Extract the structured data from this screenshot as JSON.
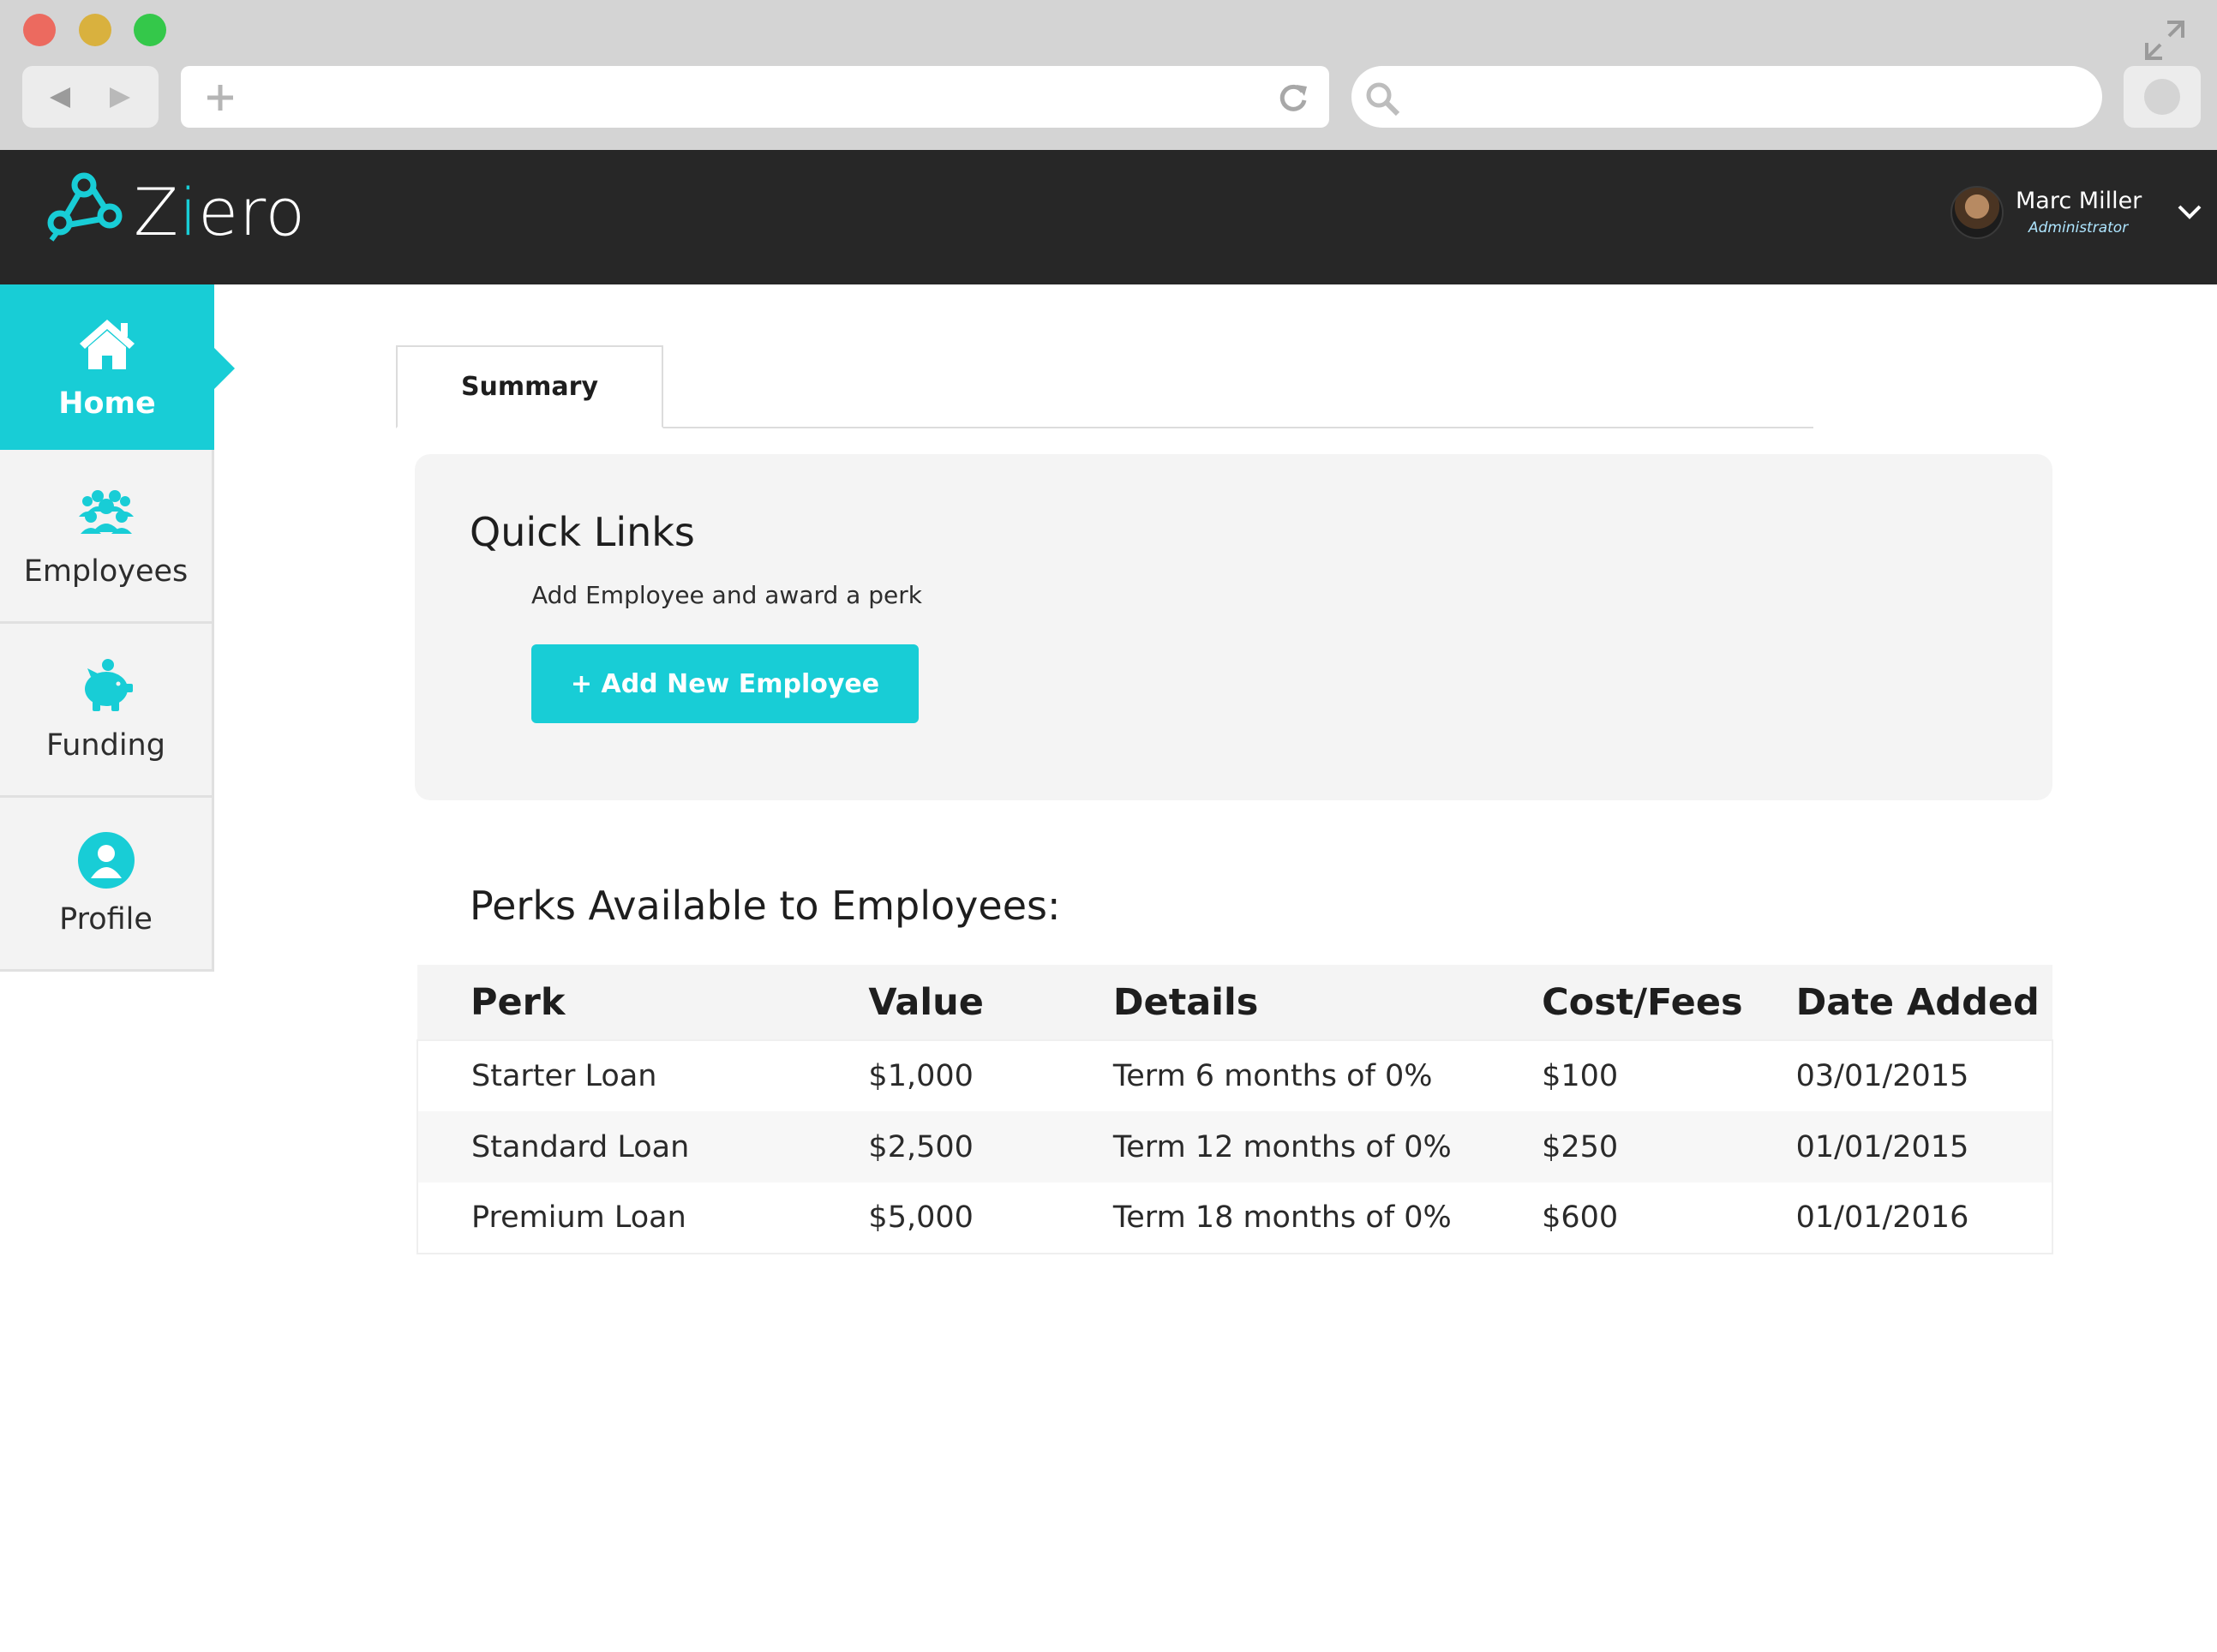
{
  "header": {
    "logo_prefix": "Z",
    "logo_i": "i",
    "logo_suffix": "ero",
    "user_name": "Marc Miller",
    "user_role": "Administrator"
  },
  "sidebar": {
    "items": [
      {
        "label": "Home",
        "icon": "home-icon"
      },
      {
        "label": "Employees",
        "icon": "employees-icon"
      },
      {
        "label": "Funding",
        "icon": "piggy-bank-icon"
      },
      {
        "label": "Profile",
        "icon": "profile-icon"
      }
    ]
  },
  "tabs": {
    "summary_label": "Summary"
  },
  "quick_links": {
    "title": "Quick Links",
    "description": "Add Employee and award a perk",
    "add_button_label": "+ Add New Employee"
  },
  "perks": {
    "title": "Perks Available to Employees:",
    "columns": [
      "Perk",
      "Value",
      "Details",
      "Cost/Fees",
      "Date Added"
    ],
    "rows": [
      [
        "Starter Loan",
        "$1,000",
        "Term 6 months of 0%",
        "$100",
        "03/01/2015"
      ],
      [
        "Standard Loan",
        "$2,500",
        "Term 12 months of 0%",
        "$250",
        "01/01/2015"
      ],
      [
        "Premium Loan",
        "$5,000",
        "Term 18 months of 0%",
        "$600",
        "01/01/2016"
      ]
    ]
  },
  "colors": {
    "accent": "#18cdd6",
    "header_bg": "#272727",
    "card_bg": "#f4f4f4"
  }
}
